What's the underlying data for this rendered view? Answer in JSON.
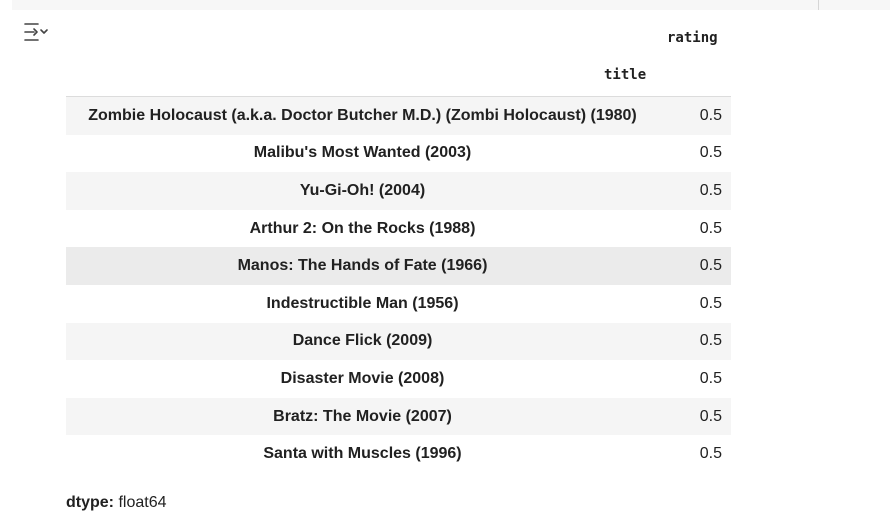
{
  "series_output": {
    "index_name": "title",
    "value_name": "rating",
    "rows": [
      {
        "title": "Zombie Holocaust (a.k.a. Doctor Butcher M.D.) (Zombi Holocaust) (1980)",
        "rating": "0.5"
      },
      {
        "title": "Malibu's Most Wanted (2003)",
        "rating": "0.5"
      },
      {
        "title": "Yu-Gi-Oh! (2004)",
        "rating": "0.5"
      },
      {
        "title": "Arthur 2: On the Rocks (1988)",
        "rating": "0.5"
      },
      {
        "title": "Manos: The Hands of Fate (1966)",
        "rating": "0.5"
      },
      {
        "title": "Indestructible Man (1956)",
        "rating": "0.5"
      },
      {
        "title": "Dance Flick (2009)",
        "rating": "0.5"
      },
      {
        "title": "Disaster Movie (2008)",
        "rating": "0.5"
      },
      {
        "title": "Bratz: The Movie (2007)",
        "rating": "0.5"
      },
      {
        "title": "Santa with Muscles (1996)",
        "rating": "0.5"
      }
    ],
    "dtype_label": "dtype:",
    "dtype_value": "float64"
  },
  "toolbar": {
    "output_icon": "output-actions-icon"
  }
}
